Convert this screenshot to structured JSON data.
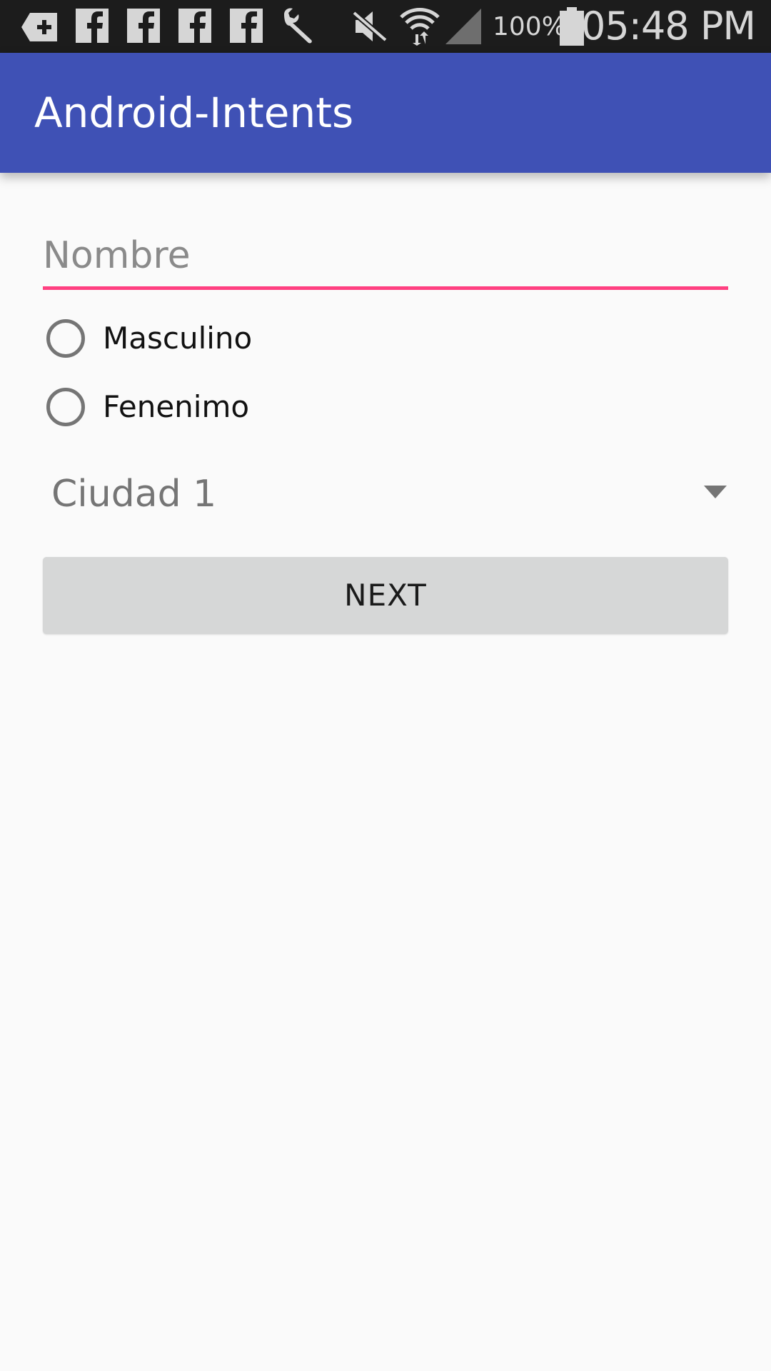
{
  "status_bar": {
    "battery_percent": "100%",
    "time": "05:48 PM",
    "icons": [
      "new-tab-icon",
      "facebook-icon",
      "facebook-icon",
      "facebook-icon",
      "facebook-icon",
      "wrench-icon",
      "mute-icon",
      "wifi-icon",
      "signal-icon",
      "battery-icon"
    ]
  },
  "app_bar": {
    "title": "Android-Intents",
    "color": "#3f51b5"
  },
  "form": {
    "name_field": {
      "placeholder": "Nombre",
      "value": "",
      "accent_color": "#ff4081"
    },
    "gender_options": [
      {
        "label": "Masculino",
        "checked": false
      },
      {
        "label": "Fenenimo",
        "checked": false
      }
    ],
    "city_spinner": {
      "selected": "Ciudad 1"
    },
    "next_button": {
      "label": "NEXT"
    }
  }
}
